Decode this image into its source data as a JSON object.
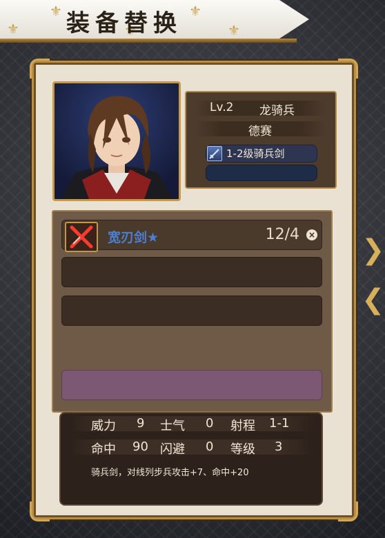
{
  "header": {
    "title": "装备替换"
  },
  "character": {
    "level": "Lv.2",
    "class": "龙骑兵",
    "name": "德赛",
    "equipped_weapon": "1-2级骑兵剑",
    "portrait_icon": "character-portrait"
  },
  "equipment_list": {
    "items": [
      {
        "name": "宽刃剑★",
        "count": "12/4",
        "icon": "crossed-sword-icon"
      }
    ]
  },
  "stats": {
    "row1": [
      {
        "label": "威力",
        "value": "9"
      },
      {
        "label": "士气",
        "value": "0"
      },
      {
        "label": "射程",
        "value": "1-1"
      }
    ],
    "row2": [
      {
        "label": "命中",
        "value": "90"
      },
      {
        "label": "闪避",
        "value": "0"
      },
      {
        "label": "等级",
        "value": "3"
      }
    ],
    "description": "骑兵剑，对线列步兵攻击+7、命中+20"
  },
  "colors": {
    "accent": "#c69a4a",
    "item_name": "#4b7fd4",
    "purple_slot": "#7c5874"
  }
}
